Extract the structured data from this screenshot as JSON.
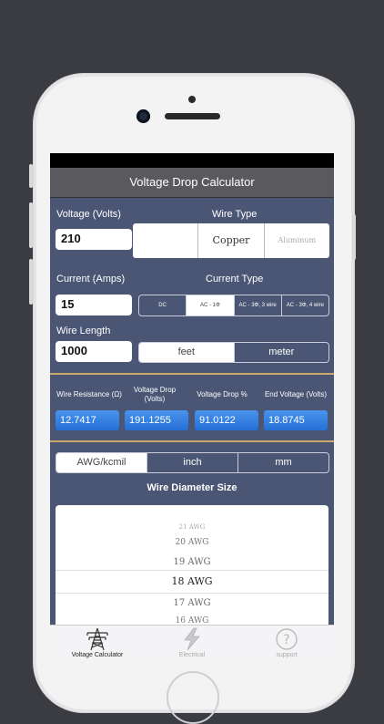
{
  "header": {
    "title": "Voltage Drop Calculator"
  },
  "inputs": {
    "voltage_label": "Voltage (Volts)",
    "voltage_value": "210",
    "current_label": "Current (Amps)",
    "current_value": "15",
    "length_label": "Wire Length",
    "length_value": "1000"
  },
  "wire_type": {
    "label": "Wire Type",
    "options": [
      "",
      "Copper",
      "Aluminum"
    ],
    "selected": "Copper"
  },
  "current_type": {
    "label": "Current Type",
    "options": [
      "DC",
      "AC - 1Φ",
      "AC - 3Φ, 3 wire",
      "AC - 3Φ, 4 wire"
    ],
    "selected": "AC - 1Φ"
  },
  "length_unit": {
    "options": [
      "feet",
      "meter"
    ],
    "selected": "meter"
  },
  "results": {
    "wire_resistance_label": "Wire Resistance (Ω)",
    "wire_resistance_value": "12.7417",
    "voltage_drop_label": "Voltage Drop (Volts)",
    "voltage_drop_value": "191.1255",
    "voltage_drop_pct_label": "Voltage Drop %",
    "voltage_drop_pct_value": "91.0122",
    "end_voltage_label": "End Voltage (Volts)",
    "end_voltage_value": "18.8745"
  },
  "size_unit": {
    "options": [
      "AWG/kcmil",
      "inch",
      "mm"
    ],
    "selected": "AWG/kcmil"
  },
  "diameter": {
    "title": "Wire Diameter Size",
    "items": [
      "21 AWG",
      "20 AWG",
      "19 AWG",
      "18 AWG",
      "17 AWG",
      "16 AWG"
    ],
    "selected": "18 AWG"
  },
  "tabbar": {
    "items": [
      "Voltage Calculator",
      "Electrical",
      "support"
    ],
    "selected": "Voltage Calculator"
  },
  "colors": {
    "screen_bg": "#4a5674",
    "accent_blue": "#2f7bdc",
    "divider_gold": "#c9a86a"
  }
}
